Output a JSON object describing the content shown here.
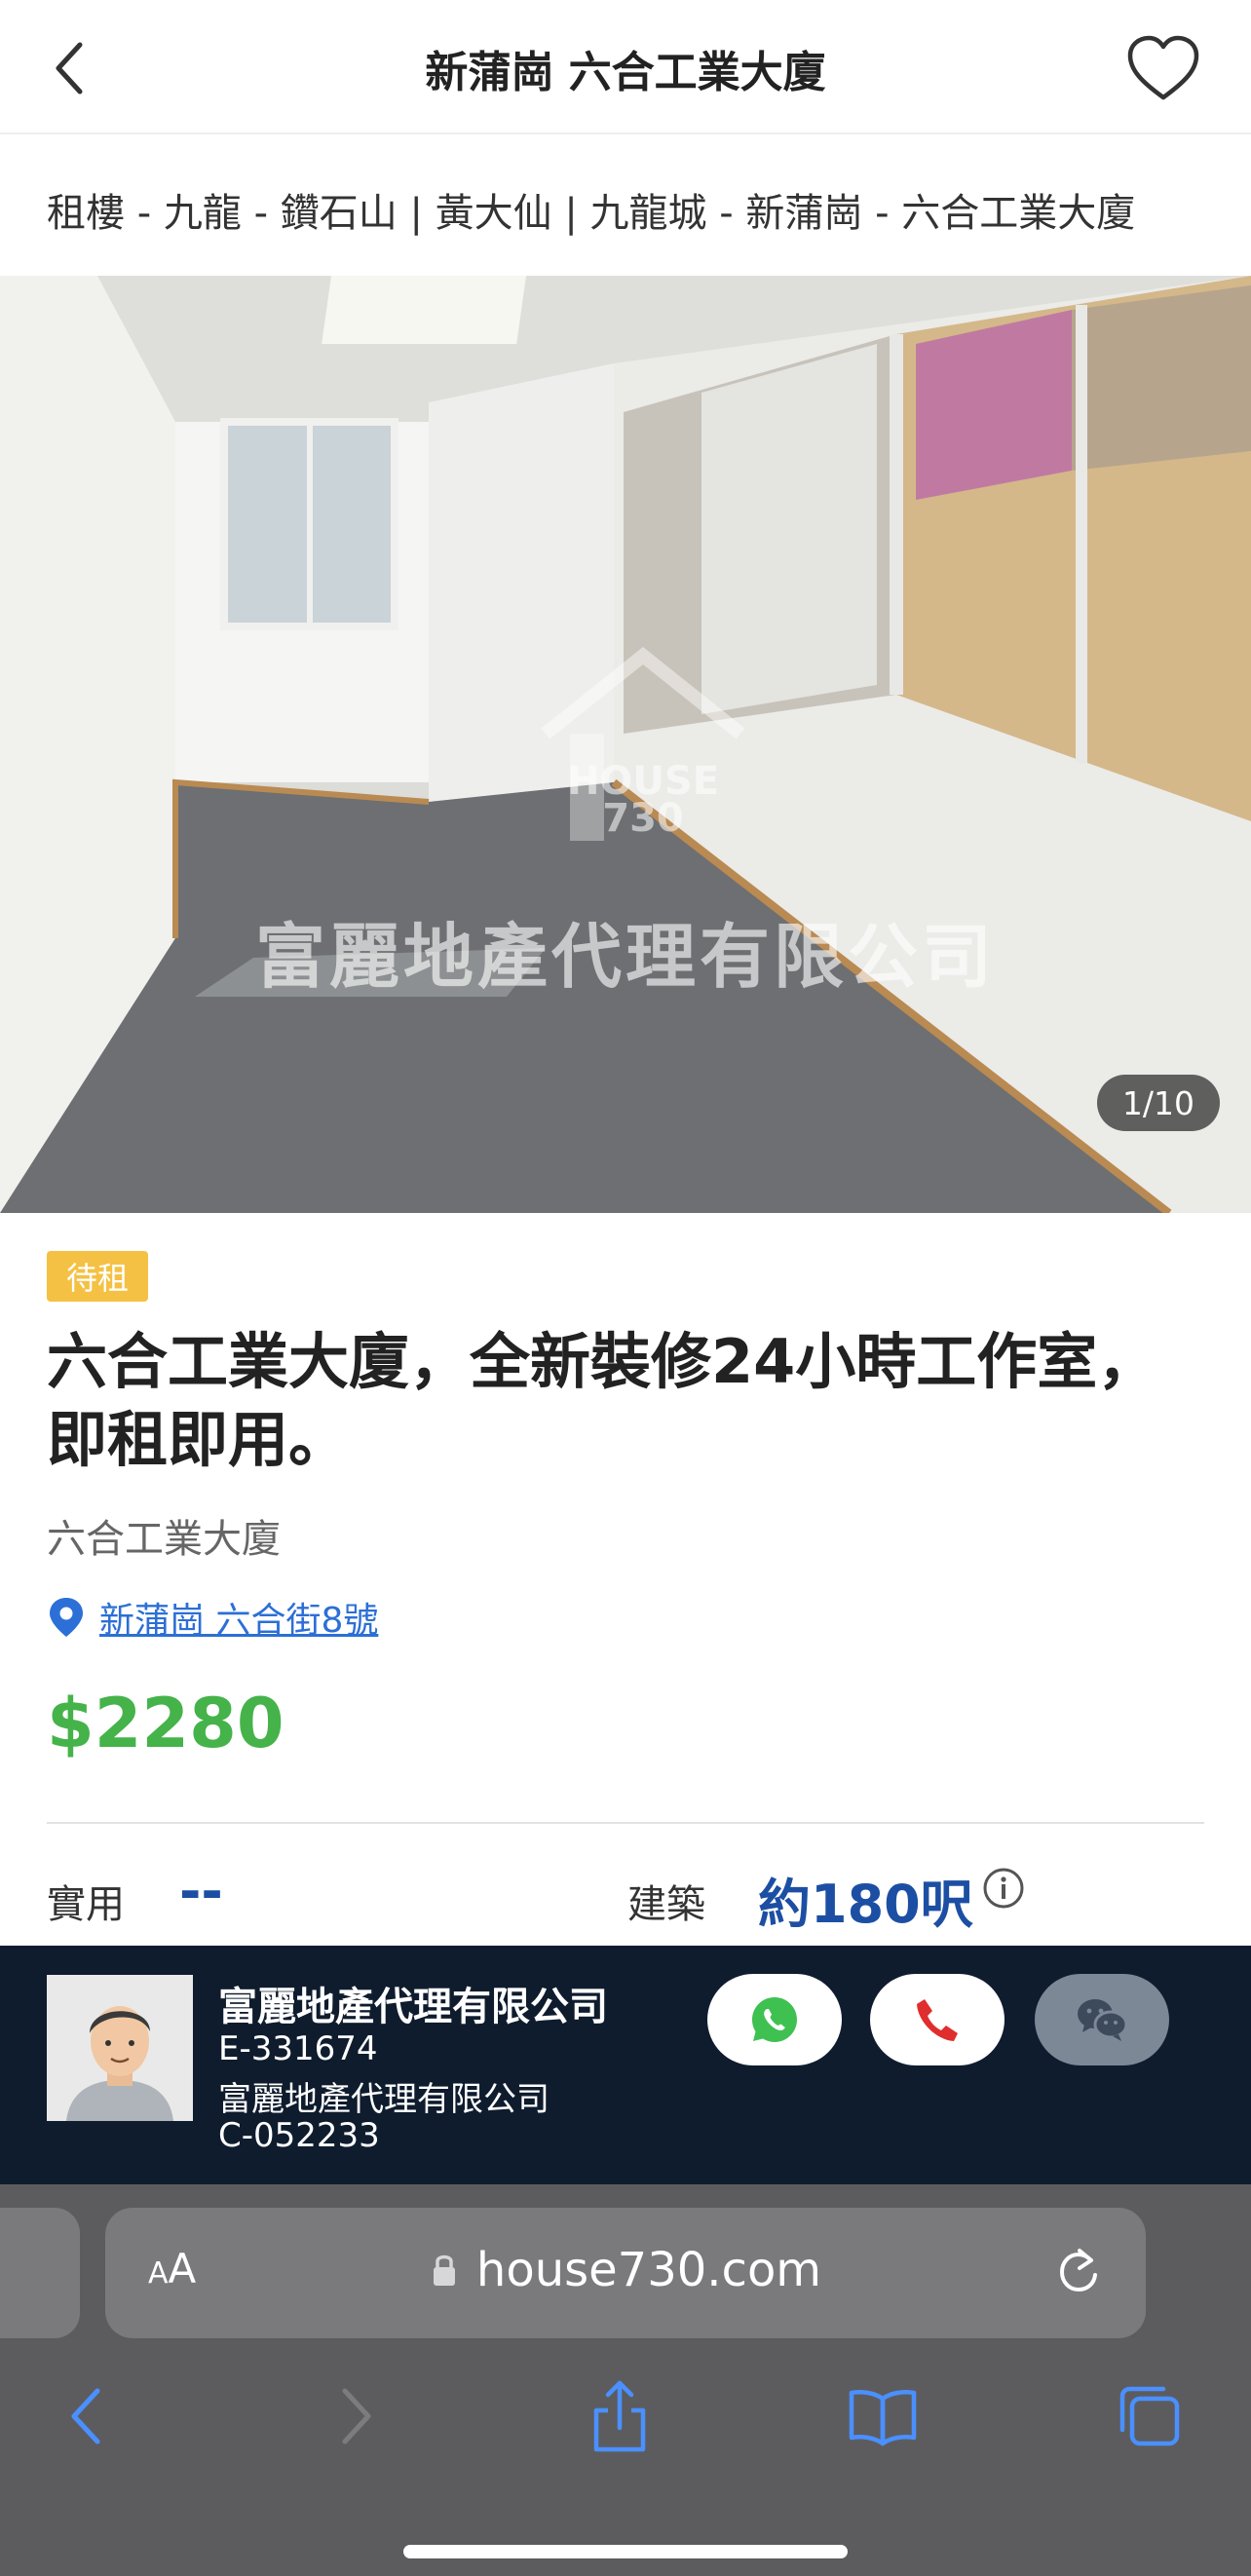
{
  "nav": {
    "title": "新蒲崗 六合工業大廈"
  },
  "breadcrumb": "租樓 - 九龍 - 鑽石山 | 黃大仙 | 九龍城 - 新蒲崗 - 六合工業大廈",
  "photo": {
    "counter": "1/10",
    "watermark_company": "富麗地產代理有限公司",
    "watermark_brand_line1": "HOUSE",
    "watermark_brand_line2": "730"
  },
  "listing": {
    "status_badge": "待租",
    "title": "六合工業大廈，全新裝修24小時工作室，即租即用。",
    "building": "六合工業大廈",
    "address": "新蒲崗 六合街8號",
    "price": "$2280"
  },
  "specs": {
    "saleable_label": "實用",
    "saleable_value": "--",
    "gross_label": "建築",
    "gross_value": "約180呎"
  },
  "agent": {
    "name": "富麗地產代理有限公司",
    "licence": "E-331674",
    "company": "富麗地產代理有限公司",
    "company_licence": "C-052233"
  },
  "browser": {
    "aa_label_small": "A",
    "aa_label_large": "A",
    "url": "house730.com"
  },
  "colors": {
    "price_green": "#45b34a",
    "link_blue": "#2c6fd6",
    "spec_blue": "#1c4fa3",
    "badge_yellow": "#f5c144",
    "agent_bar_bg": "#0f1c2e",
    "ios_blue": "#4a90ff"
  }
}
